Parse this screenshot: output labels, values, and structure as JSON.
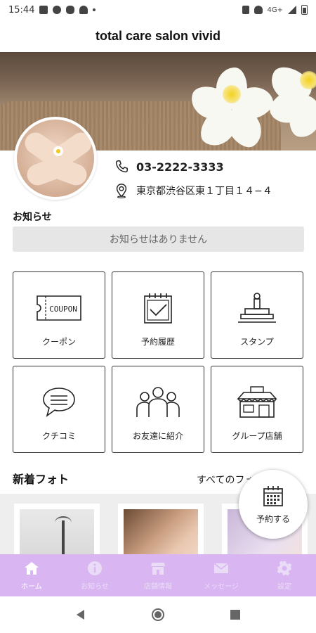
{
  "status_bar": {
    "time": "15:44",
    "network": "4G+"
  },
  "app_title": "total care salon vivid",
  "contact": {
    "phone": "03-2222-3333",
    "address": "東京都渋谷区東１丁目１４−４"
  },
  "notice": {
    "heading": "お知らせ",
    "empty_text": "お知らせはありません"
  },
  "menu_tiles": [
    {
      "label": "クーポン",
      "icon": "coupon-icon"
    },
    {
      "label": "予約履歴",
      "icon": "calendar-check-icon"
    },
    {
      "label": "スタンプ",
      "icon": "stamp-icon"
    },
    {
      "label": "クチコミ",
      "icon": "speech-bubble-icon"
    },
    {
      "label": "お友達に紹介",
      "icon": "people-icon"
    },
    {
      "label": "グループ店舗",
      "icon": "store-icon"
    }
  ],
  "coupon_icon_text": "COUPON",
  "photos": {
    "heading": "新着フォト",
    "see_all": "すべてのフォトを見る"
  },
  "fab": {
    "label": "予約する"
  },
  "bottom_nav": [
    {
      "label": "ホーム",
      "icon": "home-icon",
      "active": true
    },
    {
      "label": "お知らせ",
      "icon": "info-icon",
      "active": false
    },
    {
      "label": "店舗情報",
      "icon": "shop-icon",
      "active": false
    },
    {
      "label": "メッセージ",
      "icon": "mail-icon",
      "active": false
    },
    {
      "label": "設定",
      "icon": "gear-icon",
      "active": false
    }
  ],
  "colors": {
    "nav_bg": "#d9b6f2",
    "notice_bg": "#e6e6e6",
    "photos_bg": "#eeeeee"
  }
}
